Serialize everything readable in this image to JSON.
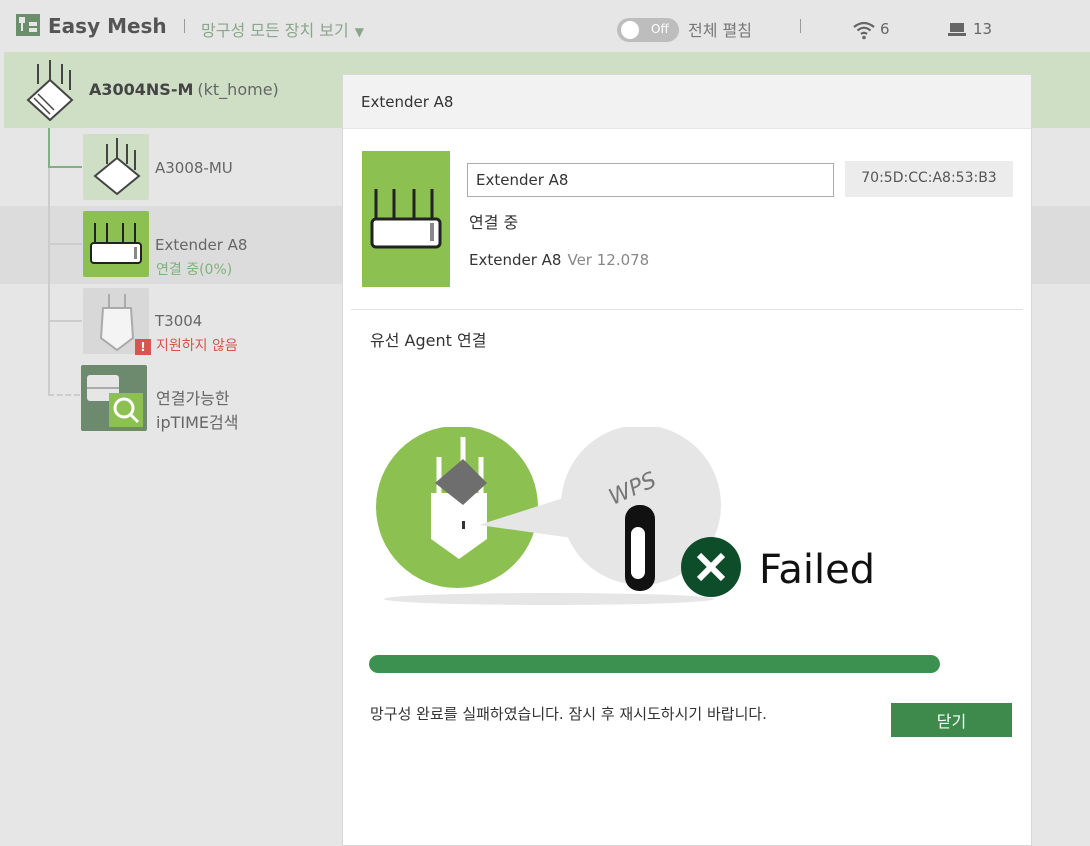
{
  "header": {
    "app_title": "Easy Mesh",
    "view_all_label": "망구성 모든 장치 보기",
    "toggle_label": "Off",
    "expand_all_label": "전체 펼침",
    "wifi_count": "6",
    "pc_count": "13"
  },
  "tree": {
    "root": {
      "name": "A3004NS-M",
      "sub": "(kt_home)"
    },
    "nodes": [
      {
        "name": "A3008-MU",
        "status": ""
      },
      {
        "name": "Extender A8",
        "status": "연결 중(0%)"
      },
      {
        "name": "T3004",
        "status": "지원하지 않음"
      }
    ],
    "search": {
      "line1": "연결가능한",
      "line2": "ipTIME검색"
    }
  },
  "dialog": {
    "title": "Extender A8",
    "name_value": "Extender A8",
    "mac": "70:5D:CC:A8:53:B3",
    "status": "연결 중",
    "model": "Extender A8",
    "version": "Ver 12.078",
    "wired_title": "유선 Agent 연결",
    "illustration": {
      "wps_text": "WPS",
      "result_text": "Failed"
    },
    "progress_percent": 100,
    "fail_message": "망구성 완료를 실패하였습니다. 잠시 후 재시도하시기 바랍니다.",
    "close_label": "닫기"
  },
  "colors": {
    "accent_green": "#8cc152",
    "dark_green": "#3d8a4c",
    "status_green": "#7fb07f",
    "error_red": "#d9534f"
  }
}
